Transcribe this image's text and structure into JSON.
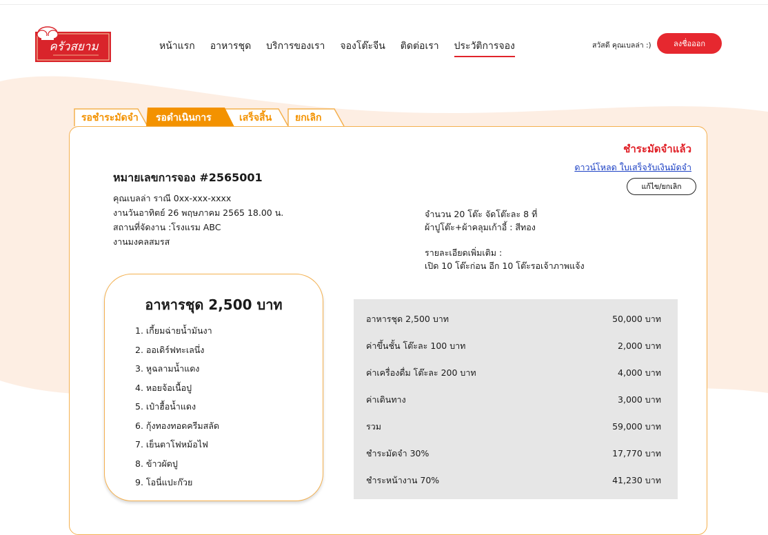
{
  "header": {
    "logo_text": "ครัวสยาม",
    "nav": [
      {
        "label": "หน้าแรก",
        "active": false
      },
      {
        "label": "อาหารชุด",
        "active": false
      },
      {
        "label": "บริการของเรา",
        "active": false
      },
      {
        "label": "จองโต๊ะจีน",
        "active": false
      },
      {
        "label": "ติดต่อเรา",
        "active": false
      },
      {
        "label": "ประวัติการจอง",
        "active": true
      }
    ],
    "greeting": "สวัสดี คุณเบลล่า :)",
    "logout_label": "ลงชื่อออก"
  },
  "tabs": [
    {
      "label": "รอชำระมัดจำ",
      "active": false
    },
    {
      "label": "รอดำเนินการ",
      "active": true
    },
    {
      "label": "เสร็จสิ้น",
      "active": false
    },
    {
      "label": "ยกเลิก",
      "active": false
    }
  ],
  "booking": {
    "status": "ชำระมัดจำแล้ว",
    "download_label": "ดาวน์โหลด ใบเสร็จรับเงินมัดจำ",
    "edit_label": "แก้ไข/ยกเลิก",
    "number": "หมายเลขการจอง #2565001",
    "customer": "คุณเบลล่า ราณี 0xx-xxx-xxxx",
    "event_date": "งานวันอาทิตย์ 26 พฤษภาคม 2565 18.00 น.",
    "venue": "สถานที่จัดงาน :โรงแรม ABC",
    "event_type": "งานมงคลสมรส",
    "tables": "จำนวน 20 โต๊ะ จัดโต๊ะละ 8 ที่",
    "cloth": "ผ้าปูโต๊ะ+ผ้าคลุมเก้าอี้ : สีทอง",
    "more_title": "รายละเอียดเพิ่มเติม :",
    "more_text": "เปิด 10 โต๊ะก่อน อีก 10 โต๊ะรอเจ้าภาพแจ้ง"
  },
  "menu": {
    "title": "อาหารชุด 2,500 บาท",
    "items": [
      "1. เกี้ยมฉ่ายน้ำมันงา",
      "2. ออเดิร์ฟทะเลนึ่ง",
      "3. หูฉลามน้ำแดง",
      "4. หอยจ้อเนื้อปู",
      "5. เป๋าฮื้อน้ำแดง",
      "6. กุ้งทองทอดครีมสลัด",
      "7. เย็นตาโฟหม้อไฟ",
      "8. ข้าวผัดปู",
      "9. โอนี่แปะก๊วย"
    ]
  },
  "costs": [
    {
      "label": "อาหารชุด 2,500 บาท",
      "amount": "50,000 บาท"
    },
    {
      "label": "ค่าขึ้นชั้น โต๊ะละ 100 บาท",
      "amount": "2,000 บาท"
    },
    {
      "label": "ค่าเครื่องดื่ม โต๊ะละ 200 บาท",
      "amount": "4,000 บาท"
    },
    {
      "label": "ค่าเดินทาง",
      "amount": "3,000 บาท"
    },
    {
      "label": "รวม",
      "amount": "59,000 บาท"
    },
    {
      "label": "ชำระมัดจำ 30%",
      "amount": "17,770 บาท"
    },
    {
      "label": "ชำระหน้างาน 70%",
      "amount": "41,230 บาท"
    }
  ],
  "colors": {
    "accent": "#f39200",
    "red": "#e6282f",
    "peach": "#fdeee3",
    "link": "#1a3fc4"
  }
}
